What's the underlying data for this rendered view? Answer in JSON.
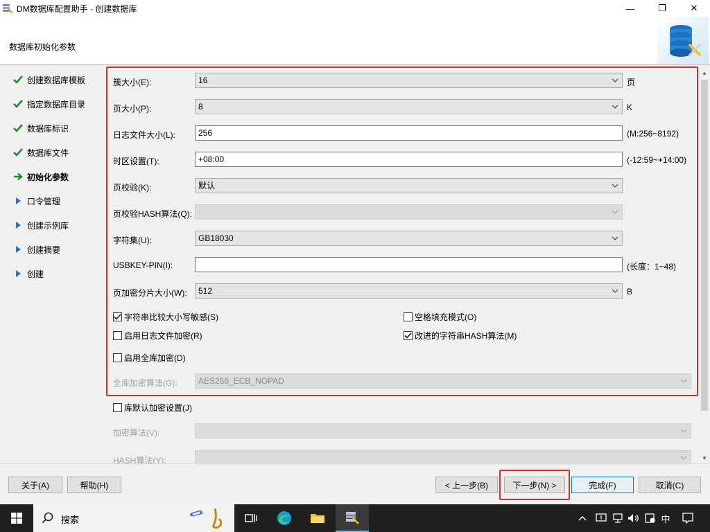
{
  "window": {
    "title": "DM数据库配置助手 - 创建数据库",
    "minimize_glyph": "—",
    "maximize_glyph": "❐",
    "close_glyph": "✕"
  },
  "header": {
    "step_title": "数据库初始化参数",
    "logo_icon": "database-config-icon"
  },
  "nav": {
    "items": [
      {
        "label": "创建数据库模板",
        "state": "done"
      },
      {
        "label": "指定数据库目录",
        "state": "done"
      },
      {
        "label": "数据库标识",
        "state": "done"
      },
      {
        "label": "数据库文件",
        "state": "done"
      },
      {
        "label": "初始化参数",
        "state": "current"
      },
      {
        "label": "口令管理",
        "state": "pending"
      },
      {
        "label": "创建示例库",
        "state": "pending"
      },
      {
        "label": "创建摘要",
        "state": "pending"
      },
      {
        "label": "创建",
        "state": "pending"
      }
    ]
  },
  "form": {
    "extent_size": {
      "label": "簇大小(E):",
      "value": "16",
      "suffix": "页"
    },
    "page_size": {
      "label": "页大小(P):",
      "value": "8",
      "suffix": "K"
    },
    "log_size": {
      "label": "日志文件大小(L):",
      "value": "256",
      "suffix": "(M:256~8192)"
    },
    "time_zone": {
      "label": "时区设置(T):",
      "value": "+08:00",
      "suffix": "(-12:59~+14:00)"
    },
    "page_check": {
      "label": "页校验(K):",
      "value": "默认"
    },
    "page_hash": {
      "label": "页校验HASH算法(Q):",
      "value": ""
    },
    "charset": {
      "label": "字符集(U):",
      "value": "GB18030"
    },
    "usbkey_pin": {
      "label": "USBKEY-PIN(I):",
      "value": "",
      "suffix": "(长度：1~48)"
    },
    "enc_slice": {
      "label": "页加密分片大小(W):",
      "value": "512",
      "suffix": "B"
    },
    "case_sensitive": {
      "label": "字符串比较大小写敏感(S)",
      "checked": true
    },
    "blank_pad": {
      "label": "空格填充模式(O)",
      "checked": false
    },
    "log_encrypt": {
      "label": "启用日志文件加密(R)",
      "checked": false
    },
    "improved_hash": {
      "label": "改进的字符串HASH算法(M)",
      "checked": true
    },
    "full_encrypt": {
      "label": "启用全库加密(D)",
      "checked": false
    },
    "full_enc_algo": {
      "label": "全库加密算法(G):",
      "value": "AES256_ECB_NOPAD"
    },
    "default_enc": {
      "label": "库默认加密设置(J)",
      "checked": false
    },
    "enc_algo": {
      "label": "加密算法(V):",
      "value": ""
    },
    "hash_algo": {
      "label": "HASH算法(Y):",
      "value": ""
    }
  },
  "buttons": {
    "about": "关于(A)",
    "help": "帮助(H)",
    "back": "< 上一步(B)",
    "next": "下一步(N) >",
    "finish": "完成(F)",
    "cancel": "取消(C)"
  },
  "taskbar": {
    "search_placeholder": "搜索",
    "ime_label": "中",
    "apps": [
      "task-view-icon",
      "edge-icon",
      "file-explorer-icon",
      "dm-config-icon"
    ]
  },
  "colors": {
    "highlight_frame": "#e8262a",
    "check_green": "#1a8a2e",
    "arrow_blue": "#1e74c8"
  }
}
